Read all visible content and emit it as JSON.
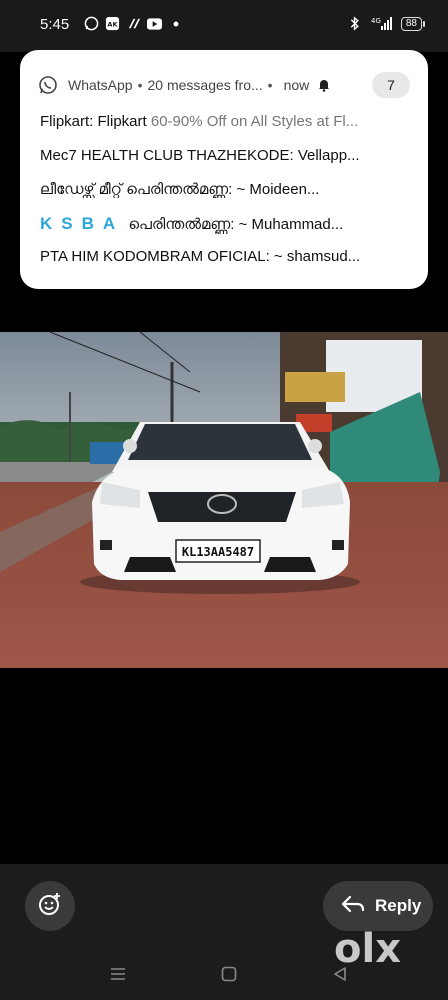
{
  "status_bar": {
    "time": "5:45",
    "left_icons": [
      "whatsapp-icon",
      "ak-app-icon",
      "app-icon",
      "youtube-icon",
      "dot-icon"
    ],
    "right_icons": [
      "bluetooth-icon",
      "4g-signal-icon"
    ],
    "network": "4G",
    "battery": "88"
  },
  "notification": {
    "app_name": "WhatsApp",
    "separator": "•",
    "summary": "20 messages fro...",
    "time": "now",
    "count": "7",
    "messages": [
      {
        "sender": "Flipkart: Flipkart",
        "body_bold": "60-90",
        "body": "% Off on All Styles at Fl..."
      },
      {
        "sender": "Mec7 HEALTH CLUB  THAZHEKODE: Vellapp..."
      },
      {
        "sender": "ലീഡേഴ്സ് മീറ്റ് പെരിന്തൽമണ്ണ: ~ Moideen..."
      },
      {
        "prefix": "KSBA",
        "sender": "പെരിന്തൽമണ്ണ: ~ Muhammad..."
      },
      {
        "sender": "PTA HIM KODOMBRAM OFICIAL: ~ shamsud..."
      }
    ]
  },
  "photo": {
    "plate": "KL13AA5487"
  },
  "bottom": {
    "reply_label": "Reply",
    "logo": "olx",
    "sticker_icon": "sticker-icon"
  },
  "nav": [
    "menu-icon",
    "home-icon",
    "back-icon"
  ]
}
